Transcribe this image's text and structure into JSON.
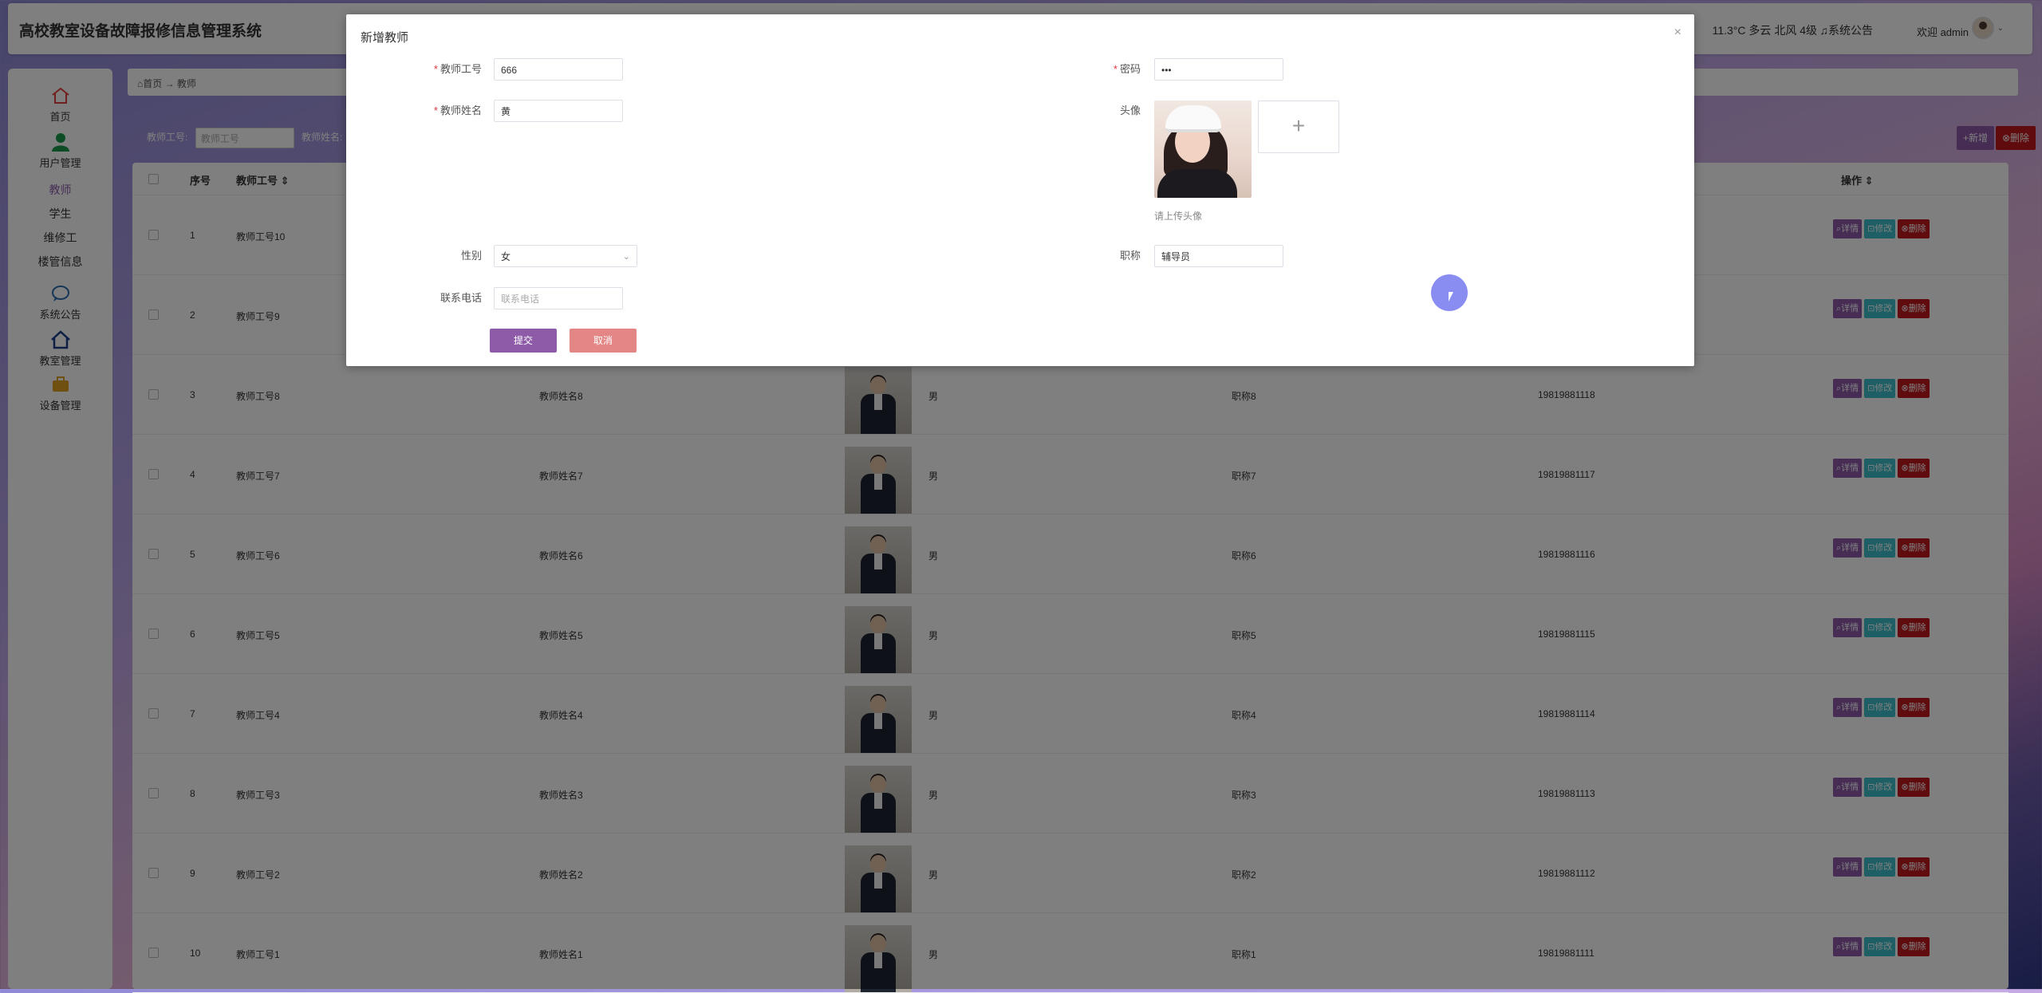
{
  "app": {
    "title": "高校教室设备故障报修信息管理系统"
  },
  "header": {
    "weather": "11.3°C 多云 北风 4级",
    "notice": "♫系统公告",
    "welcome": "欢迎 admin",
    "chevron": "⌄"
  },
  "sidebar": {
    "home": "首页",
    "users": "用户管理",
    "teacher": "教师",
    "student": "学生",
    "maintainer": "维修工",
    "dorm": "楼管信息",
    "notice": "系统公告",
    "classroom": "教室管理",
    "device": "设备管理"
  },
  "breadcrumb": "⌂首页  →  教师",
  "search": {
    "label1": "教师工号:",
    "placeholder1": "教师工号",
    "label2": "教师姓名:"
  },
  "toolbar": {
    "add": "+新增",
    "delete": "⊗删除"
  },
  "table": {
    "headers": {
      "index": "序号",
      "teacher_no": "教师工号 ⇕",
      "actions": "操作 ⇕"
    },
    "actions": {
      "detail": "⌕详情",
      "edit": "⊡修改",
      "delete": "⊗删除"
    },
    "rows": [
      {
        "index": "1",
        "teacher_no": "教师工号10"
      },
      {
        "index": "2",
        "teacher_no": "教师工号9"
      },
      {
        "index": "3",
        "teacher_no": "教师工号8",
        "name": "教师姓名8",
        "gender": "男",
        "title": "职称8",
        "phone": "19819881118"
      },
      {
        "index": "4",
        "teacher_no": "教师工号7",
        "name": "教师姓名7",
        "gender": "男",
        "title": "职称7",
        "phone": "19819881117"
      },
      {
        "index": "5",
        "teacher_no": "教师工号6",
        "name": "教师姓名6",
        "gender": "男",
        "title": "职称6",
        "phone": "19819881116"
      },
      {
        "index": "6",
        "teacher_no": "教师工号5",
        "name": "教师姓名5",
        "gender": "男",
        "title": "职称5",
        "phone": "19819881115"
      },
      {
        "index": "7",
        "teacher_no": "教师工号4",
        "name": "教师姓名4",
        "gender": "男",
        "title": "职称4",
        "phone": "19819881114"
      },
      {
        "index": "8",
        "teacher_no": "教师工号3",
        "name": "教师姓名3",
        "gender": "男",
        "title": "职称3",
        "phone": "19819881113"
      },
      {
        "index": "9",
        "teacher_no": "教师工号2",
        "name": "教师姓名2",
        "gender": "男",
        "title": "职称2",
        "phone": "19819881112"
      },
      {
        "index": "10",
        "teacher_no": "教师工号1",
        "name": "教师姓名1",
        "gender": "男",
        "title": "职称1",
        "phone": "19819881111"
      }
    ]
  },
  "modal": {
    "title": "新增教师",
    "close": "×",
    "fields": {
      "teacher_no": {
        "label": "教师工号",
        "value": "666"
      },
      "password": {
        "label": "密码",
        "value": "•••"
      },
      "name": {
        "label": "教师姓名",
        "value": "黄"
      },
      "avatar": {
        "label": "头像",
        "hint": "请上传头像",
        "add": "+"
      },
      "gender": {
        "label": "性别",
        "value": "女",
        "caret": "⌄"
      },
      "title": {
        "label": "职称",
        "value": "辅导员"
      },
      "phone": {
        "label": "联系电话",
        "placeholder": "联系电话"
      }
    },
    "submit": "提交",
    "cancel": "取消",
    "required_mark": "*"
  },
  "colors": {
    "accent": "#8e5ba9",
    "danger": "#c0181f",
    "info": "#3bbfca",
    "cancel": "#e58686"
  }
}
